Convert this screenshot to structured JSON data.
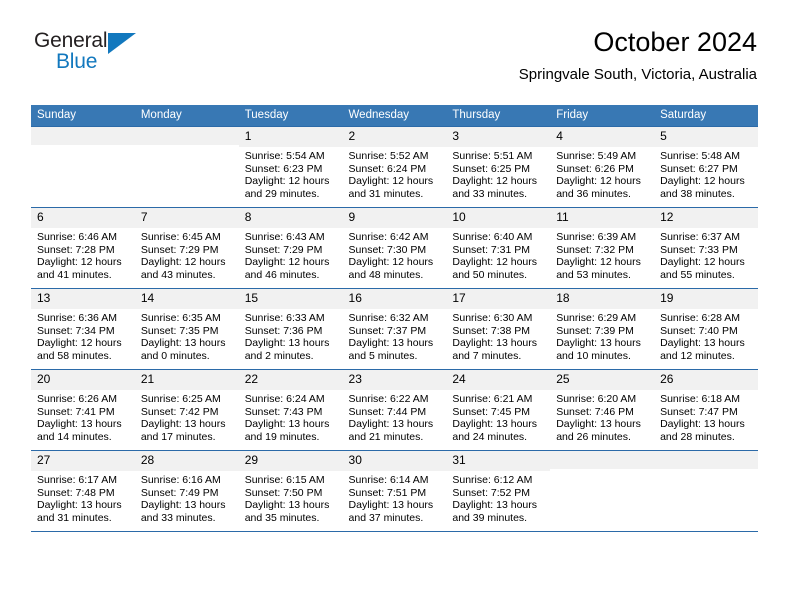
{
  "brand": {
    "word1": "General",
    "word2": "Blue",
    "triangle_icon": "brand-triangle-icon",
    "color_blue": "#1278be",
    "color_dark": "#231f20"
  },
  "header": {
    "title": "October 2024",
    "location": "Springvale South, Victoria, Australia"
  },
  "theme": {
    "header_row_bg": "#3878b4",
    "grid_line": "#2b6aa8",
    "daynum_bg": "#f1f1f1"
  },
  "weekdays": [
    "Sunday",
    "Monday",
    "Tuesday",
    "Wednesday",
    "Thursday",
    "Friday",
    "Saturday"
  ],
  "weeks": [
    [
      {
        "day": "",
        "blank": true
      },
      {
        "day": "",
        "blank": true
      },
      {
        "day": "1",
        "sunrise": "Sunrise: 5:54 AM",
        "sunset": "Sunset: 6:23 PM",
        "daylight": "Daylight: 12 hours and 29 minutes."
      },
      {
        "day": "2",
        "sunrise": "Sunrise: 5:52 AM",
        "sunset": "Sunset: 6:24 PM",
        "daylight": "Daylight: 12 hours and 31 minutes."
      },
      {
        "day": "3",
        "sunrise": "Sunrise: 5:51 AM",
        "sunset": "Sunset: 6:25 PM",
        "daylight": "Daylight: 12 hours and 33 minutes."
      },
      {
        "day": "4",
        "sunrise": "Sunrise: 5:49 AM",
        "sunset": "Sunset: 6:26 PM",
        "daylight": "Daylight: 12 hours and 36 minutes."
      },
      {
        "day": "5",
        "sunrise": "Sunrise: 5:48 AM",
        "sunset": "Sunset: 6:27 PM",
        "daylight": "Daylight: 12 hours and 38 minutes."
      }
    ],
    [
      {
        "day": "6",
        "sunrise": "Sunrise: 6:46 AM",
        "sunset": "Sunset: 7:28 PM",
        "daylight": "Daylight: 12 hours and 41 minutes."
      },
      {
        "day": "7",
        "sunrise": "Sunrise: 6:45 AM",
        "sunset": "Sunset: 7:29 PM",
        "daylight": "Daylight: 12 hours and 43 minutes."
      },
      {
        "day": "8",
        "sunrise": "Sunrise: 6:43 AM",
        "sunset": "Sunset: 7:29 PM",
        "daylight": "Daylight: 12 hours and 46 minutes."
      },
      {
        "day": "9",
        "sunrise": "Sunrise: 6:42 AM",
        "sunset": "Sunset: 7:30 PM",
        "daylight": "Daylight: 12 hours and 48 minutes."
      },
      {
        "day": "10",
        "sunrise": "Sunrise: 6:40 AM",
        "sunset": "Sunset: 7:31 PM",
        "daylight": "Daylight: 12 hours and 50 minutes."
      },
      {
        "day": "11",
        "sunrise": "Sunrise: 6:39 AM",
        "sunset": "Sunset: 7:32 PM",
        "daylight": "Daylight: 12 hours and 53 minutes."
      },
      {
        "day": "12",
        "sunrise": "Sunrise: 6:37 AM",
        "sunset": "Sunset: 7:33 PM",
        "daylight": "Daylight: 12 hours and 55 minutes."
      }
    ],
    [
      {
        "day": "13",
        "sunrise": "Sunrise: 6:36 AM",
        "sunset": "Sunset: 7:34 PM",
        "daylight": "Daylight: 12 hours and 58 minutes."
      },
      {
        "day": "14",
        "sunrise": "Sunrise: 6:35 AM",
        "sunset": "Sunset: 7:35 PM",
        "daylight": "Daylight: 13 hours and 0 minutes."
      },
      {
        "day": "15",
        "sunrise": "Sunrise: 6:33 AM",
        "sunset": "Sunset: 7:36 PM",
        "daylight": "Daylight: 13 hours and 2 minutes."
      },
      {
        "day": "16",
        "sunrise": "Sunrise: 6:32 AM",
        "sunset": "Sunset: 7:37 PM",
        "daylight": "Daylight: 13 hours and 5 minutes."
      },
      {
        "day": "17",
        "sunrise": "Sunrise: 6:30 AM",
        "sunset": "Sunset: 7:38 PM",
        "daylight": "Daylight: 13 hours and 7 minutes."
      },
      {
        "day": "18",
        "sunrise": "Sunrise: 6:29 AM",
        "sunset": "Sunset: 7:39 PM",
        "daylight": "Daylight: 13 hours and 10 minutes."
      },
      {
        "day": "19",
        "sunrise": "Sunrise: 6:28 AM",
        "sunset": "Sunset: 7:40 PM",
        "daylight": "Daylight: 13 hours and 12 minutes."
      }
    ],
    [
      {
        "day": "20",
        "sunrise": "Sunrise: 6:26 AM",
        "sunset": "Sunset: 7:41 PM",
        "daylight": "Daylight: 13 hours and 14 minutes."
      },
      {
        "day": "21",
        "sunrise": "Sunrise: 6:25 AM",
        "sunset": "Sunset: 7:42 PM",
        "daylight": "Daylight: 13 hours and 17 minutes."
      },
      {
        "day": "22",
        "sunrise": "Sunrise: 6:24 AM",
        "sunset": "Sunset: 7:43 PM",
        "daylight": "Daylight: 13 hours and 19 minutes."
      },
      {
        "day": "23",
        "sunrise": "Sunrise: 6:22 AM",
        "sunset": "Sunset: 7:44 PM",
        "daylight": "Daylight: 13 hours and 21 minutes."
      },
      {
        "day": "24",
        "sunrise": "Sunrise: 6:21 AM",
        "sunset": "Sunset: 7:45 PM",
        "daylight": "Daylight: 13 hours and 24 minutes."
      },
      {
        "day": "25",
        "sunrise": "Sunrise: 6:20 AM",
        "sunset": "Sunset: 7:46 PM",
        "daylight": "Daylight: 13 hours and 26 minutes."
      },
      {
        "day": "26",
        "sunrise": "Sunrise: 6:18 AM",
        "sunset": "Sunset: 7:47 PM",
        "daylight": "Daylight: 13 hours and 28 minutes."
      }
    ],
    [
      {
        "day": "27",
        "sunrise": "Sunrise: 6:17 AM",
        "sunset": "Sunset: 7:48 PM",
        "daylight": "Daylight: 13 hours and 31 minutes."
      },
      {
        "day": "28",
        "sunrise": "Sunrise: 6:16 AM",
        "sunset": "Sunset: 7:49 PM",
        "daylight": "Daylight: 13 hours and 33 minutes."
      },
      {
        "day": "29",
        "sunrise": "Sunrise: 6:15 AM",
        "sunset": "Sunset: 7:50 PM",
        "daylight": "Daylight: 13 hours and 35 minutes."
      },
      {
        "day": "30",
        "sunrise": "Sunrise: 6:14 AM",
        "sunset": "Sunset: 7:51 PM",
        "daylight": "Daylight: 13 hours and 37 minutes."
      },
      {
        "day": "31",
        "sunrise": "Sunrise: 6:12 AM",
        "sunset": "Sunset: 7:52 PM",
        "daylight": "Daylight: 13 hours and 39 minutes."
      },
      {
        "day": "",
        "blank": true
      },
      {
        "day": "",
        "blank": true
      }
    ]
  ]
}
